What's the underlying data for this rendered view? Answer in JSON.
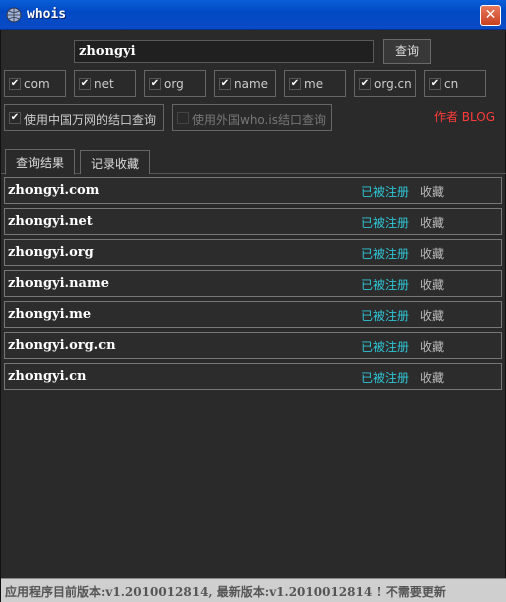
{
  "window": {
    "title": "whois",
    "close_glyph": "✕"
  },
  "search": {
    "value": "zhongyi",
    "button_label": "查询"
  },
  "tlds": [
    {
      "label": "com",
      "checked": true
    },
    {
      "label": "net",
      "checked": true
    },
    {
      "label": "org",
      "checked": true
    },
    {
      "label": "name",
      "checked": true
    },
    {
      "label": "me",
      "checked": true
    },
    {
      "label": "org.cn",
      "checked": true
    },
    {
      "label": "cn",
      "checked": true
    }
  ],
  "options": {
    "china_api": {
      "label": "使用中国万网的结口查询",
      "checked": true
    },
    "foreign_api": {
      "label": "使用外国who.is结口查询",
      "checked": false
    }
  },
  "author_link": "作者 BLOG",
  "tabs": [
    {
      "label": "查询结果",
      "active": true
    },
    {
      "label": "记录收藏",
      "active": false
    }
  ],
  "results": [
    {
      "domain": "zhongyi.com",
      "status": "已被注册",
      "action": "收藏"
    },
    {
      "domain": "zhongyi.net",
      "status": "已被注册",
      "action": "收藏"
    },
    {
      "domain": "zhongyi.org",
      "status": "已被注册",
      "action": "收藏"
    },
    {
      "domain": "zhongyi.name",
      "status": "已被注册",
      "action": "收藏"
    },
    {
      "domain": "zhongyi.me",
      "status": "已被注册",
      "action": "收藏"
    },
    {
      "domain": "zhongyi.org.cn",
      "status": "已被注册",
      "action": "收藏"
    },
    {
      "domain": "zhongyi.cn",
      "status": "已被注册",
      "action": "收藏"
    }
  ],
  "statusbar": "应用程序目前版本:v1.2010012814, 最新版本:v1.2010012814 ! 不需要更新",
  "colors": {
    "status_registered": "#2fc6d6",
    "author_link": "#ff3b3b",
    "titlebar": "#0149c4"
  },
  "icons": {
    "app": "whois-globe-icon",
    "close": "close-icon",
    "check": "check-icon"
  }
}
